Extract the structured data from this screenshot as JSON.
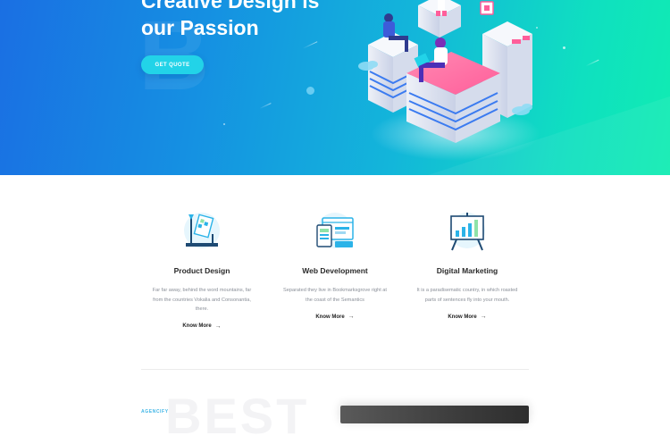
{
  "hero": {
    "headline_line1": "Creative Design is",
    "headline_line2": "our Passion",
    "cta_label": "GET QUOTE",
    "gradient_start": "#1a6fe3",
    "gradient_end": "#10ecb2"
  },
  "features": [
    {
      "icon": "paint-palette-icon",
      "title": "Product Design",
      "description": "Far far away, behind the word mountains, far from the countries Vokalia and Consonantia, there.",
      "link_label": "Know More"
    },
    {
      "icon": "browser-window-icon",
      "title": "Web Development",
      "description": "Separated they live in Bookmarksgrove right at the coast of the Semantics",
      "link_label": "Know More"
    },
    {
      "icon": "bar-chart-board-icon",
      "title": "Digital Marketing",
      "description": "It is a paradisematic country, in which roasted parts of sentences fly into your mouth.",
      "link_label": "Know More"
    }
  ],
  "next_section": {
    "label": "AGENCIFY",
    "background_word": "BEST"
  },
  "colors": {
    "accent": "#22d3e8",
    "icon_primary": "#2bb3e8",
    "text_dark": "#2a2a2a",
    "text_muted": "#8a8f98"
  }
}
